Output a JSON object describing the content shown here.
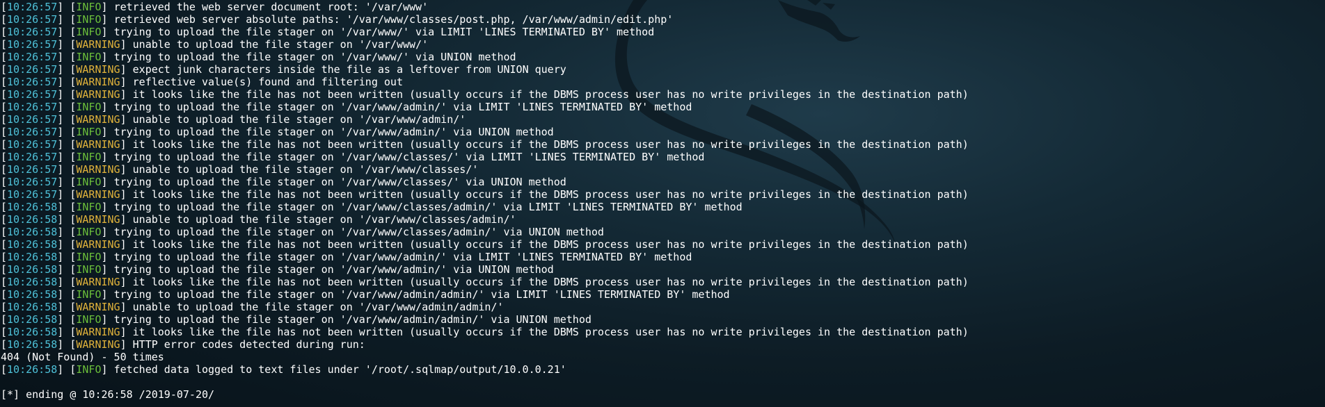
{
  "log": [
    {
      "time": "10:26:57",
      "level": "INFO",
      "message": "retrieved the web server document root: '/var/www'"
    },
    {
      "time": "10:26:57",
      "level": "INFO",
      "message": "retrieved web server absolute paths: '/var/www/classes/post.php, /var/www/admin/edit.php'"
    },
    {
      "time": "10:26:57",
      "level": "INFO",
      "message": "trying to upload the file stager on '/var/www/' via LIMIT 'LINES TERMINATED BY' method"
    },
    {
      "time": "10:26:57",
      "level": "WARNING",
      "message": "unable to upload the file stager on '/var/www/'"
    },
    {
      "time": "10:26:57",
      "level": "INFO",
      "message": "trying to upload the file stager on '/var/www/' via UNION method"
    },
    {
      "time": "10:26:57",
      "level": "WARNING",
      "message": "expect junk characters inside the file as a leftover from UNION query"
    },
    {
      "time": "10:26:57",
      "level": "WARNING",
      "message": "reflective value(s) found and filtering out"
    },
    {
      "time": "10:26:57",
      "level": "WARNING",
      "message": "it looks like the file has not been written (usually occurs if the DBMS process user has no write privileges in the destination path)"
    },
    {
      "time": "10:26:57",
      "level": "INFO",
      "message": "trying to upload the file stager on '/var/www/admin/' via LIMIT 'LINES TERMINATED BY' method"
    },
    {
      "time": "10:26:57",
      "level": "WARNING",
      "message": "unable to upload the file stager on '/var/www/admin/'"
    },
    {
      "time": "10:26:57",
      "level": "INFO",
      "message": "trying to upload the file stager on '/var/www/admin/' via UNION method"
    },
    {
      "time": "10:26:57",
      "level": "WARNING",
      "message": "it looks like the file has not been written (usually occurs if the DBMS process user has no write privileges in the destination path)"
    },
    {
      "time": "10:26:57",
      "level": "INFO",
      "message": "trying to upload the file stager on '/var/www/classes/' via LIMIT 'LINES TERMINATED BY' method"
    },
    {
      "time": "10:26:57",
      "level": "WARNING",
      "message": "unable to upload the file stager on '/var/www/classes/'"
    },
    {
      "time": "10:26:57",
      "level": "INFO",
      "message": "trying to upload the file stager on '/var/www/classes/' via UNION method"
    },
    {
      "time": "10:26:57",
      "level": "WARNING",
      "message": "it looks like the file has not been written (usually occurs if the DBMS process user has no write privileges in the destination path)"
    },
    {
      "time": "10:26:58",
      "level": "INFO",
      "message": "trying to upload the file stager on '/var/www/classes/admin/' via LIMIT 'LINES TERMINATED BY' method"
    },
    {
      "time": "10:26:58",
      "level": "WARNING",
      "message": "unable to upload the file stager on '/var/www/classes/admin/'"
    },
    {
      "time": "10:26:58",
      "level": "INFO",
      "message": "trying to upload the file stager on '/var/www/classes/admin/' via UNION method"
    },
    {
      "time": "10:26:58",
      "level": "WARNING",
      "message": "it looks like the file has not been written (usually occurs if the DBMS process user has no write privileges in the destination path)"
    },
    {
      "time": "10:26:58",
      "level": "INFO",
      "message": "trying to upload the file stager on '/var/www/admin/' via LIMIT 'LINES TERMINATED BY' method"
    },
    {
      "time": "10:26:58",
      "level": "INFO",
      "message": "trying to upload the file stager on '/var/www/admin/' via UNION method"
    },
    {
      "time": "10:26:58",
      "level": "WARNING",
      "message": "it looks like the file has not been written (usually occurs if the DBMS process user has no write privileges in the destination path)"
    },
    {
      "time": "10:26:58",
      "level": "INFO",
      "message": "trying to upload the file stager on '/var/www/admin/admin/' via LIMIT 'LINES TERMINATED BY' method"
    },
    {
      "time": "10:26:58",
      "level": "WARNING",
      "message": "unable to upload the file stager on '/var/www/admin/admin/'"
    },
    {
      "time": "10:26:58",
      "level": "INFO",
      "message": "trying to upload the file stager on '/var/www/admin/admin/' via UNION method"
    },
    {
      "time": "10:26:58",
      "level": "WARNING",
      "message": "it looks like the file has not been written (usually occurs if the DBMS process user has no write privileges in the destination path)"
    },
    {
      "time": "10:26:58",
      "level": "WARNING",
      "message": "HTTP error codes detected during run:"
    },
    {
      "plain": "404 (Not Found) - 50 times"
    },
    {
      "time": "10:26:58",
      "level": "INFO",
      "message": "fetched data logged to text files under '/root/.sqlmap/output/10.0.0.21'"
    },
    {
      "blank": true
    },
    {
      "plain": "[*] ending @ 10:26:58 /2019-07-20/"
    }
  ],
  "colors": {
    "timestamp": "#4ec1d8",
    "info": "#6bbf3a",
    "warning": "#e0b23a",
    "text": "#ffffff",
    "background": "#0d1c25"
  },
  "wallpaper_icon": "kali-dragon-icon"
}
